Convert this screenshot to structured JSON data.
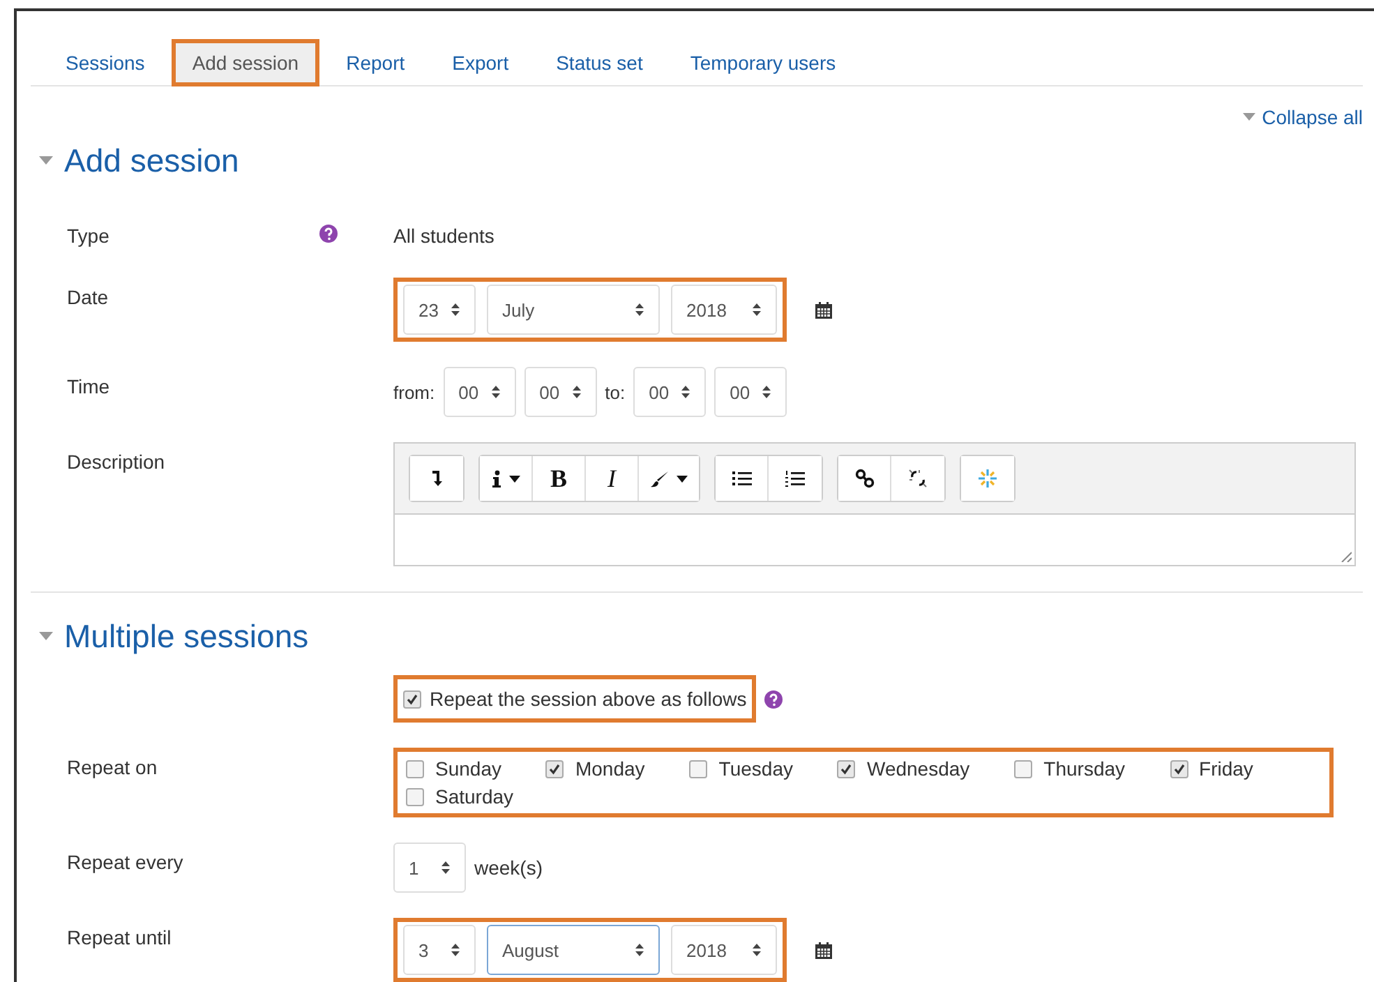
{
  "tabs": [
    {
      "label": "Sessions",
      "selected": false,
      "highlighted": false
    },
    {
      "label": "Add session",
      "selected": true,
      "highlighted": true
    },
    {
      "label": "Report",
      "selected": false,
      "highlighted": false
    },
    {
      "label": "Export",
      "selected": false,
      "highlighted": false
    },
    {
      "label": "Status set",
      "selected": false,
      "highlighted": false
    },
    {
      "label": "Temporary users",
      "selected": false,
      "highlighted": false
    }
  ],
  "collapse_all": "Collapse all",
  "add_session": {
    "heading": "Add session",
    "expanded": true,
    "type": {
      "label": "Type",
      "value": "All students"
    },
    "date": {
      "label": "Date",
      "highlighted": true,
      "selects": [
        {
          "value": "23"
        },
        {
          "value": "July"
        },
        {
          "value": "2018"
        }
      ]
    },
    "time": {
      "label": "Time",
      "from": "from:",
      "to": "to:",
      "selects": [
        {
          "value": "00"
        },
        {
          "value": "00"
        },
        {
          "value": "00"
        },
        {
          "value": "00"
        }
      ]
    },
    "description": {
      "label": "Description",
      "toolbar": [
        [
          {
            "kind": "indent"
          }
        ],
        [
          {
            "kind": "info",
            "dropdown": true
          },
          {
            "kind": "bold",
            "label": "B"
          },
          {
            "kind": "italic",
            "label": "I"
          },
          {
            "kind": "brush",
            "dropdown": true
          }
        ],
        [
          {
            "kind": "bullets"
          },
          {
            "kind": "numbers"
          }
        ],
        [
          {
            "kind": "link"
          },
          {
            "kind": "unlink"
          }
        ],
        [
          {
            "kind": "sparkle"
          }
        ]
      ]
    }
  },
  "multiple_sessions": {
    "heading": "Multiple sessions",
    "expanded": true,
    "repeat": {
      "label": "Repeat the session above as follows",
      "checked": true,
      "highlighted": true
    },
    "repeat_on": {
      "label": "Repeat on",
      "highlighted": true,
      "days": [
        {
          "label": "Sunday",
          "checked": false
        },
        {
          "label": "Monday",
          "checked": true
        },
        {
          "label": "Tuesday",
          "checked": false
        },
        {
          "label": "Wednesday",
          "checked": true
        },
        {
          "label": "Thursday",
          "checked": false
        },
        {
          "label": "Friday",
          "checked": true
        },
        {
          "label": "Saturday",
          "checked": false
        }
      ]
    },
    "repeat_every": {
      "label": "Repeat every",
      "select": {
        "value": "1"
      },
      "unit": "week(s)"
    },
    "repeat_until": {
      "label": "Repeat until",
      "highlighted": true,
      "selects": [
        {
          "value": "3",
          "focused": false
        },
        {
          "value": "August",
          "focused": true
        },
        {
          "value": "2018",
          "focused": false
        }
      ]
    }
  }
}
